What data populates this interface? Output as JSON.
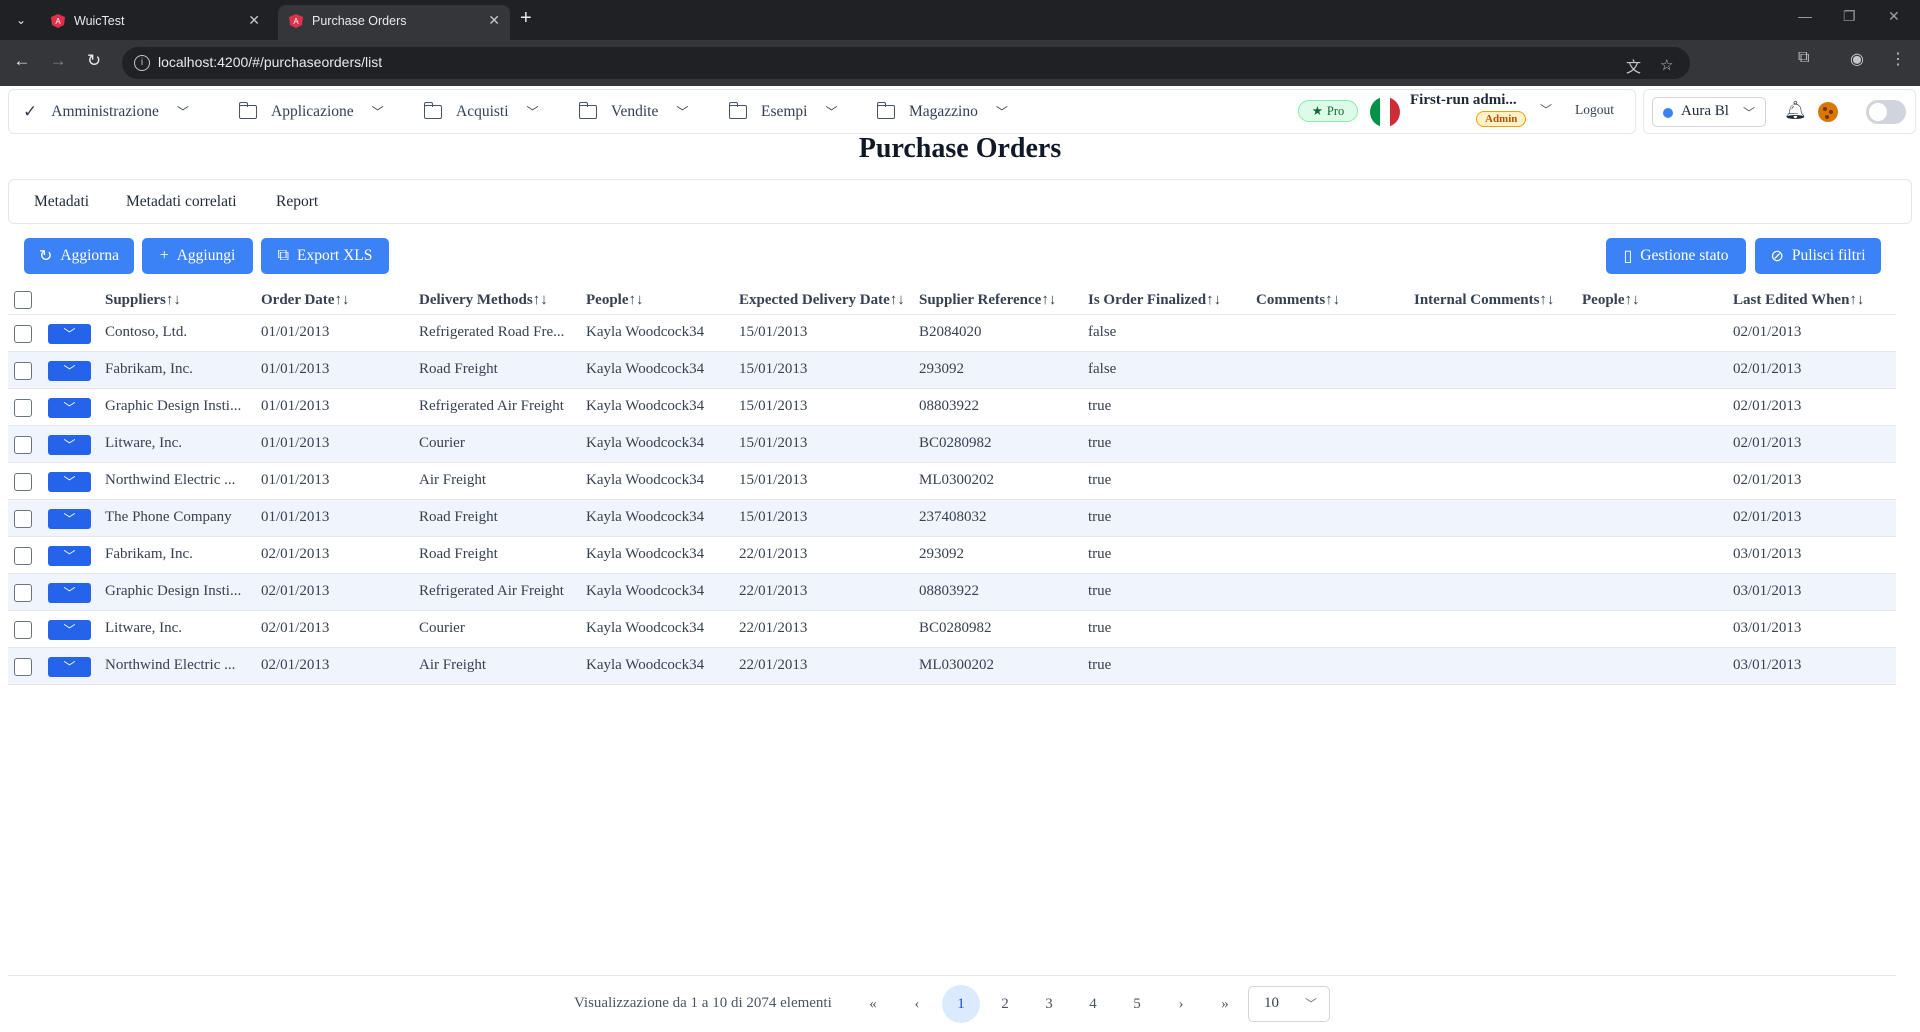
{
  "browser": {
    "tabs": [
      {
        "title": "WuicTest",
        "active": false
      },
      {
        "title": "Purchase Orders",
        "active": true
      }
    ],
    "url": "localhost:4200/#/purchaseorders/list"
  },
  "menubar": {
    "items": [
      {
        "label": "Amministrazione",
        "icon": "check-icon"
      },
      {
        "label": "Applicazione",
        "icon": "folder-icon"
      },
      {
        "label": "Acquisti",
        "icon": "folder-icon"
      },
      {
        "label": "Vendite",
        "icon": "folder-icon"
      },
      {
        "label": "Esempi",
        "icon": "folder-icon"
      },
      {
        "label": "Magazzino",
        "icon": "folder-icon"
      }
    ],
    "pro_label": "Pro",
    "user_name": "First-run admi...",
    "role_badge": "Admin",
    "logout_label": "Logout",
    "theme": "Aura Bl"
  },
  "page_title": "Purchase Orders",
  "subtabs": [
    "Metadati",
    "Metadati correlati",
    "Report"
  ],
  "toolbar": {
    "refresh_label": "Aggiorna",
    "add_label": "Aggiungi",
    "export_label": "Export XLS",
    "state_label": "Gestione stato",
    "clear_filters_label": "Pulisci filtri"
  },
  "table": {
    "sort_glyph": "↑↓",
    "columns": [
      "Suppliers",
      "Order Date",
      "Delivery Methods",
      "People",
      "Expected Delivery Date",
      "Supplier Reference",
      "Is Order Finalized",
      "Comments",
      "Internal Comments",
      "People",
      "Last Edited When"
    ],
    "rows": [
      {
        "supplier": "Contoso, Ltd.",
        "order_date": "01/01/2013",
        "delivery": "Refrigerated Road Fre...",
        "people": "Kayla Woodcock34",
        "expected": "15/01/2013",
        "reference": "B2084020",
        "finalized": "false",
        "comments": "",
        "internal_comments": "",
        "people2": "",
        "last_edited": "02/01/2013"
      },
      {
        "supplier": "Fabrikam, Inc.",
        "order_date": "01/01/2013",
        "delivery": "Road Freight",
        "people": "Kayla Woodcock34",
        "expected": "15/01/2013",
        "reference": "293092",
        "finalized": "false",
        "comments": "",
        "internal_comments": "",
        "people2": "",
        "last_edited": "02/01/2013"
      },
      {
        "supplier": "Graphic Design Insti...",
        "order_date": "01/01/2013",
        "delivery": "Refrigerated Air Freight",
        "people": "Kayla Woodcock34",
        "expected": "15/01/2013",
        "reference": "08803922",
        "finalized": "true",
        "comments": "",
        "internal_comments": "",
        "people2": "",
        "last_edited": "02/01/2013"
      },
      {
        "supplier": "Litware, Inc.",
        "order_date": "01/01/2013",
        "delivery": "Courier",
        "people": "Kayla Woodcock34",
        "expected": "15/01/2013",
        "reference": "BC0280982",
        "finalized": "true",
        "comments": "",
        "internal_comments": "",
        "people2": "",
        "last_edited": "02/01/2013"
      },
      {
        "supplier": "Northwind Electric ...",
        "order_date": "01/01/2013",
        "delivery": "Air Freight",
        "people": "Kayla Woodcock34",
        "expected": "15/01/2013",
        "reference": "ML0300202",
        "finalized": "true",
        "comments": "",
        "internal_comments": "",
        "people2": "",
        "last_edited": "02/01/2013"
      },
      {
        "supplier": "The Phone Company",
        "order_date": "01/01/2013",
        "delivery": "Road Freight",
        "people": "Kayla Woodcock34",
        "expected": "15/01/2013",
        "reference": "237408032",
        "finalized": "true",
        "comments": "",
        "internal_comments": "",
        "people2": "",
        "last_edited": "02/01/2013"
      },
      {
        "supplier": "Fabrikam, Inc.",
        "order_date": "02/01/2013",
        "delivery": "Road Freight",
        "people": "Kayla Woodcock34",
        "expected": "22/01/2013",
        "reference": "293092",
        "finalized": "true",
        "comments": "",
        "internal_comments": "",
        "people2": "",
        "last_edited": "03/01/2013"
      },
      {
        "supplier": "Graphic Design Insti...",
        "order_date": "02/01/2013",
        "delivery": "Refrigerated Air Freight",
        "people": "Kayla Woodcock34",
        "expected": "22/01/2013",
        "reference": "08803922",
        "finalized": "true",
        "comments": "",
        "internal_comments": "",
        "people2": "",
        "last_edited": "03/01/2013"
      },
      {
        "supplier": "Litware, Inc.",
        "order_date": "02/01/2013",
        "delivery": "Courier",
        "people": "Kayla Woodcock34",
        "expected": "22/01/2013",
        "reference": "BC0280982",
        "finalized": "true",
        "comments": "",
        "internal_comments": "",
        "people2": "",
        "last_edited": "03/01/2013"
      },
      {
        "supplier": "Northwind Electric ...",
        "order_date": "02/01/2013",
        "delivery": "Air Freight",
        "people": "Kayla Woodcock34",
        "expected": "22/01/2013",
        "reference": "ML0300202",
        "finalized": "true",
        "comments": "",
        "internal_comments": "",
        "people2": "",
        "last_edited": "03/01/2013"
      }
    ]
  },
  "pagination": {
    "summary": "Visualizzazione da 1 a 10 di 2074 elementi",
    "pages": [
      "1",
      "2",
      "3",
      "4",
      "5"
    ],
    "current_page": "1",
    "rows_per_page": "10"
  },
  "colors": {
    "primary": "#3b82f6",
    "row_stripe": "#eff4fd",
    "chrome_dark": "#202124"
  }
}
